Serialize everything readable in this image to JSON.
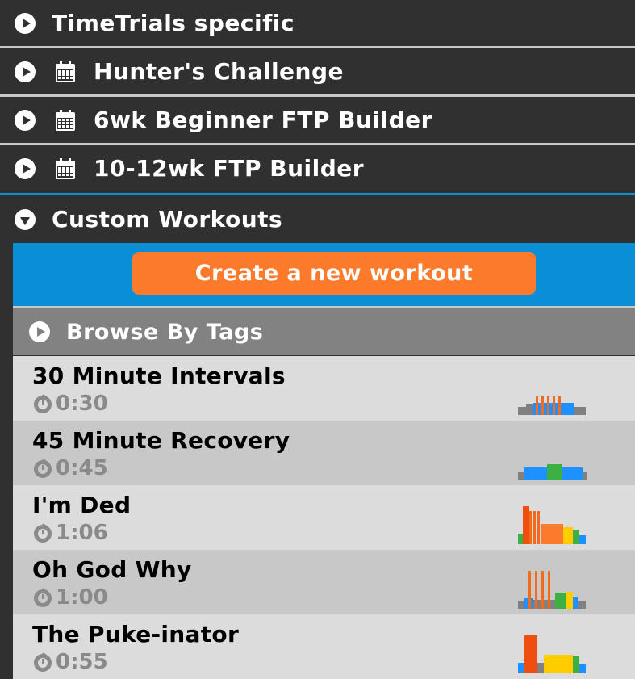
{
  "categories": [
    {
      "label": "TimeTrials specific",
      "has_calendar": false,
      "expanded": false
    },
    {
      "label": "Hunter's Challenge",
      "has_calendar": true,
      "expanded": false
    },
    {
      "label": "6wk Beginner FTP Builder",
      "has_calendar": true,
      "expanded": false
    },
    {
      "label": "10-12wk FTP Builder",
      "has_calendar": true,
      "expanded": false
    },
    {
      "label": "Custom Workouts",
      "has_calendar": false,
      "expanded": true
    }
  ],
  "create_button_label": "Create a new workout",
  "browse_label": "Browse By Tags",
  "workouts": [
    {
      "name": "30 Minute Intervals",
      "duration": "0:30"
    },
    {
      "name": "45 Minute Recovery",
      "duration": "0:45"
    },
    {
      "name": "I'm Ded",
      "duration": "1:06"
    },
    {
      "name": "Oh God Why",
      "duration": "1:00"
    },
    {
      "name": "The Puke-inator",
      "duration": "0:55"
    }
  ],
  "colors": {
    "accent_blue": "#0a8fd6",
    "button_orange": "#fb7a2c",
    "header_bg": "#303030",
    "row_light": "#dcdcdc",
    "row_dark": "#c8c8c8"
  }
}
